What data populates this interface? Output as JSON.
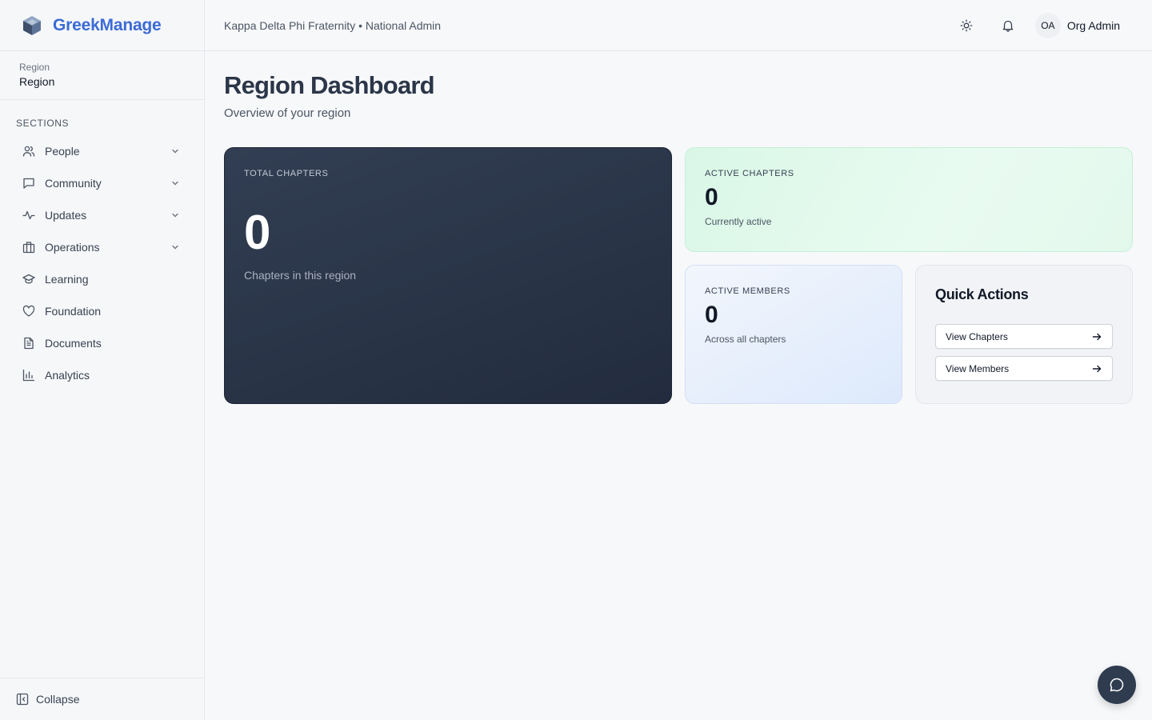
{
  "brand": {
    "name": "GreekManage",
    "accent": "#3b6bd6"
  },
  "scope": {
    "label": "Region",
    "value": "Region"
  },
  "sidebar": {
    "sections_title": "SECTIONS",
    "items": [
      {
        "label": "People",
        "icon": "users-icon",
        "expandable": true
      },
      {
        "label": "Community",
        "icon": "message-square-icon",
        "expandable": true
      },
      {
        "label": "Updates",
        "icon": "activity-icon",
        "expandable": true
      },
      {
        "label": "Operations",
        "icon": "building-icon",
        "expandable": true
      },
      {
        "label": "Learning",
        "icon": "graduation-cap-icon",
        "expandable": false
      },
      {
        "label": "Foundation",
        "icon": "heart-icon",
        "expandable": false
      },
      {
        "label": "Documents",
        "icon": "file-text-icon",
        "expandable": false
      },
      {
        "label": "Analytics",
        "icon": "bar-chart-icon",
        "expandable": false
      }
    ],
    "collapse_label": "Collapse"
  },
  "topbar": {
    "breadcrumb": "Kappa Delta Phi Fraternity • National Admin",
    "user_initials": "OA",
    "user_name": "Org Admin"
  },
  "page": {
    "title": "Region Dashboard",
    "subtitle": "Overview of your region"
  },
  "stats": {
    "total_chapters": {
      "label": "TOTAL CHAPTERS",
      "value": "0",
      "desc": "Chapters in this region"
    },
    "active_chapters": {
      "label": "ACTIVE CHAPTERS",
      "value": "0",
      "desc": "Currently active"
    },
    "active_members": {
      "label": "ACTIVE MEMBERS",
      "value": "0",
      "desc": "Across all chapters"
    }
  },
  "quick_actions": {
    "title": "Quick Actions",
    "view_chapters": "View Chapters",
    "view_members": "View Members"
  }
}
